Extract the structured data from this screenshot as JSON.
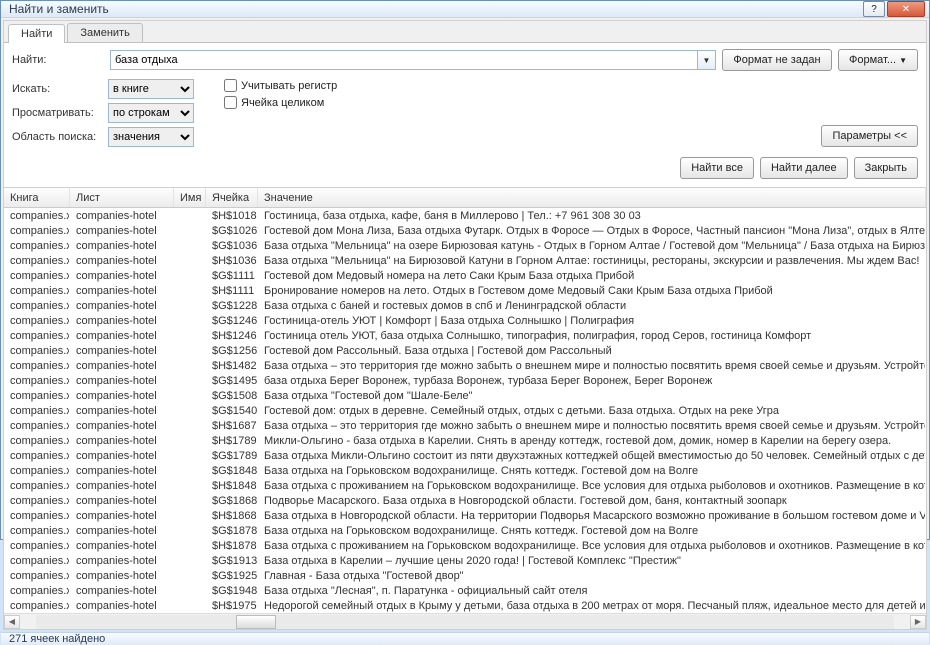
{
  "title": "Найти и заменить",
  "tabs": {
    "find": "Найти",
    "replace": "Заменить"
  },
  "findRow": {
    "label": "Найти:",
    "value": "база отдыха",
    "formatNotSet": "Формат не задан",
    "formatBtn": "Формат..."
  },
  "opts": {
    "searchInLabel": "Искать:",
    "searchInValue": "в книге",
    "lookLabel": "Просматривать:",
    "lookValue": "по строкам",
    "areaLabel": "Область поиска:",
    "areaValue": "значения",
    "matchCase": "Учитывать регистр",
    "wholeCell": "Ячейка целиком",
    "paramsBtn": "Параметры <<"
  },
  "actions": {
    "findAll": "Найти все",
    "findNext": "Найти далее",
    "close": "Закрыть"
  },
  "columns": {
    "book": "Книга",
    "sheet": "Лист",
    "name": "Имя",
    "cell": "Ячейка",
    "value": "Значение"
  },
  "rows": [
    {
      "book": "companies.xlsx",
      "sheet": "companies-hotel",
      "cell": "$H$1018",
      "value": "Гостиница, база отдыха, кафе, баня в Миллерово | Тел.: +7 961 308 30 03"
    },
    {
      "book": "companies.xlsx",
      "sheet": "companies-hotel",
      "cell": "$G$1026",
      "value": "Гостевой дом Мона Лиза, База отдыха Футарк. Отдых в Форосе — Отдых в Форосе, Частный пансион \"Мона Лиза\", отдых в Ялте, отдых в Крыму, форос, гостиницы крыма, отдых"
    },
    {
      "book": "companies.xlsx",
      "sheet": "companies-hotel",
      "cell": "$G$1036",
      "value": "База отдыха \"Мельница\" на озере Бирюзовая катунь - Отдых в Горном Алтае / Гостевой дом \"Мельница\" / База отдыха на Бирюзовой Катуни, Горный-Алтай"
    },
    {
      "book": "companies.xlsx",
      "sheet": "companies-hotel",
      "cell": "$H$1036",
      "value": "База отдыха \"Мельница\" на Бирюзовой Катуни в Горном Алтае: гостиницы, рестораны, экскурсии и развлечения. Мы ждем Вас!"
    },
    {
      "book": "companies.xlsx",
      "sheet": "companies-hotel",
      "cell": "$G$1111",
      "value": "Гостевой дом Медовый номера на лето Саки Крым База отдыха Прибой"
    },
    {
      "book": "companies.xlsx",
      "sheet": "companies-hotel",
      "cell": "$H$1111",
      "value": "Бронирование номеров на лето. Отдых в Гостевом доме Медовый Саки Крым База отдыха Прибой"
    },
    {
      "book": "companies.xlsx",
      "sheet": "companies-hotel",
      "cell": "$G$1228",
      "value": "База отдыха с баней и гостевых домов в спб и Ленинградской области"
    },
    {
      "book": "companies.xlsx",
      "sheet": "companies-hotel",
      "cell": "$G$1246",
      "value": "Гостиница-отель УЮТ | Комфорт | База отдыха Солнышко | Полиграфия"
    },
    {
      "book": "companies.xlsx",
      "sheet": "companies-hotel",
      "cell": "$H$1246",
      "value": "Гостиница отель УЮТ, база отдыха Солнышко, типография, полиграфия, город Серов, гостиница Комфорт"
    },
    {
      "book": "companies.xlsx",
      "sheet": "companies-hotel",
      "cell": "$G$1256",
      "value": "Гостевой дом Рассольный. База отдыха | Гостевой дом Рассольный"
    },
    {
      "book": "companies.xlsx",
      "sheet": "companies-hotel",
      "cell": "$H$1482",
      "value": "База отдыха – это территория где можно забыть о внешнем мире и полностью посвятить время своей семье и друзьям. Устройте незабываемые приключения на Базе отдыха"
    },
    {
      "book": "companies.xlsx",
      "sheet": "companies-hotel",
      "cell": "$G$1495",
      "value": "база отдыха Берег Воронеж, турбаза Воронеж, турбаза Берег Воронеж, Берег Воронеж"
    },
    {
      "book": "companies.xlsx",
      "sheet": "companies-hotel",
      "cell": "$G$1508",
      "value": "База отдыха \"Гостевой дом \"Шале-Беле\""
    },
    {
      "book": "companies.xlsx",
      "sheet": "companies-hotel",
      "cell": "$G$1540",
      "value": "Гостевой дом: отдых в деревне. Семейный отдых, отдых с детьми. База отдыха. Отдых на реке Угра"
    },
    {
      "book": "companies.xlsx",
      "sheet": "companies-hotel",
      "cell": "$H$1687",
      "value": "База отдыха – это территория где можно забыть о внешнем мире и полностью посвятить время своей семье и друзьям. Устройте незабываемые приключения на Базе отдыха"
    },
    {
      "book": "companies.xlsx",
      "sheet": "companies-hotel",
      "cell": "$H$1789",
      "value": "Микли-Ольгино - база отдыха в Карелии. Снять в аренду коттедж, гостевой дом, домик, номер в Карелии на берегу озера."
    },
    {
      "book": "companies.xlsx",
      "sheet": "companies-hotel",
      "cell": "$G$1789",
      "value": "База отдыха Микли-Ольгино состоит из пяти двухэтажных коттеджей общей вместимостью до 50 человек. Семейный отдых с детьми, выходные с друзьями или целый отпуск н"
    },
    {
      "book": "companies.xlsx",
      "sheet": "companies-hotel",
      "cell": "$G$1848",
      "value": "База отдыха на Горьковском водохранилище. Снять коттедж. Гостевой дом на Волге"
    },
    {
      "book": "companies.xlsx",
      "sheet": "companies-hotel",
      "cell": "$H$1848",
      "value": "База отдыха с проживанием на Горьковском водохранилище. Все условия для отдыха рыболовов и охотников. Размещение в коттеджах, питание, интернет, ТВ. Услуги егеря. "
    },
    {
      "book": "companies.xlsx",
      "sheet": "companies-hotel",
      "cell": "$G$1868",
      "value": "Подворье Масарского. База отдыха в Новгородской области. Гостевой дом, баня, контактный зоопарк"
    },
    {
      "book": "companies.xlsx",
      "sheet": "companies-hotel",
      "cell": "$H$1868",
      "value": "База отдыха в Новгородской области. На территории Подворья Масарского возможно проживание в большом гостевом доме и VIP-коттедже."
    },
    {
      "book": "companies.xlsx",
      "sheet": "companies-hotel",
      "cell": "$G$1878",
      "value": "База отдыха на Горьковском водохранилище. Снять коттедж. Гостевой дом на Волге"
    },
    {
      "book": "companies.xlsx",
      "sheet": "companies-hotel",
      "cell": "$H$1878",
      "value": "База отдыха с проживанием на Горьковском водохранилище. Все условия для отдыха рыболовов и охотников. Размещение в коттеджах, питание, интернет, ТВ. Услуги егеря. "
    },
    {
      "book": "companies.xlsx",
      "sheet": "companies-hotel",
      "cell": "$G$1913",
      "value": "База отдыха в Карелии – лучшие цены 2020 года! | Гостевой Комплекс \"Престиж\""
    },
    {
      "book": "companies.xlsx",
      "sheet": "companies-hotel",
      "cell": "$G$1925",
      "value": "Главная - База отдыха \"Гостевой двор\""
    },
    {
      "book": "companies.xlsx",
      "sheet": "companies-hotel",
      "cell": "$G$1948",
      "value": "База отдыха \"Лесная\", п. Паратунка - официальный сайт отеля"
    },
    {
      "book": "companies.xlsx",
      "sheet": "companies-hotel",
      "cell": "$H$1975",
      "value": "Недорогой семейный отдых в Крыму у детьми, база отдыха в 200 метрах от моря. Песчаный пляж, идеальное место для детей и родителей, уютные номера с удобствами"
    }
  ],
  "status": "271 ячеек найдено"
}
